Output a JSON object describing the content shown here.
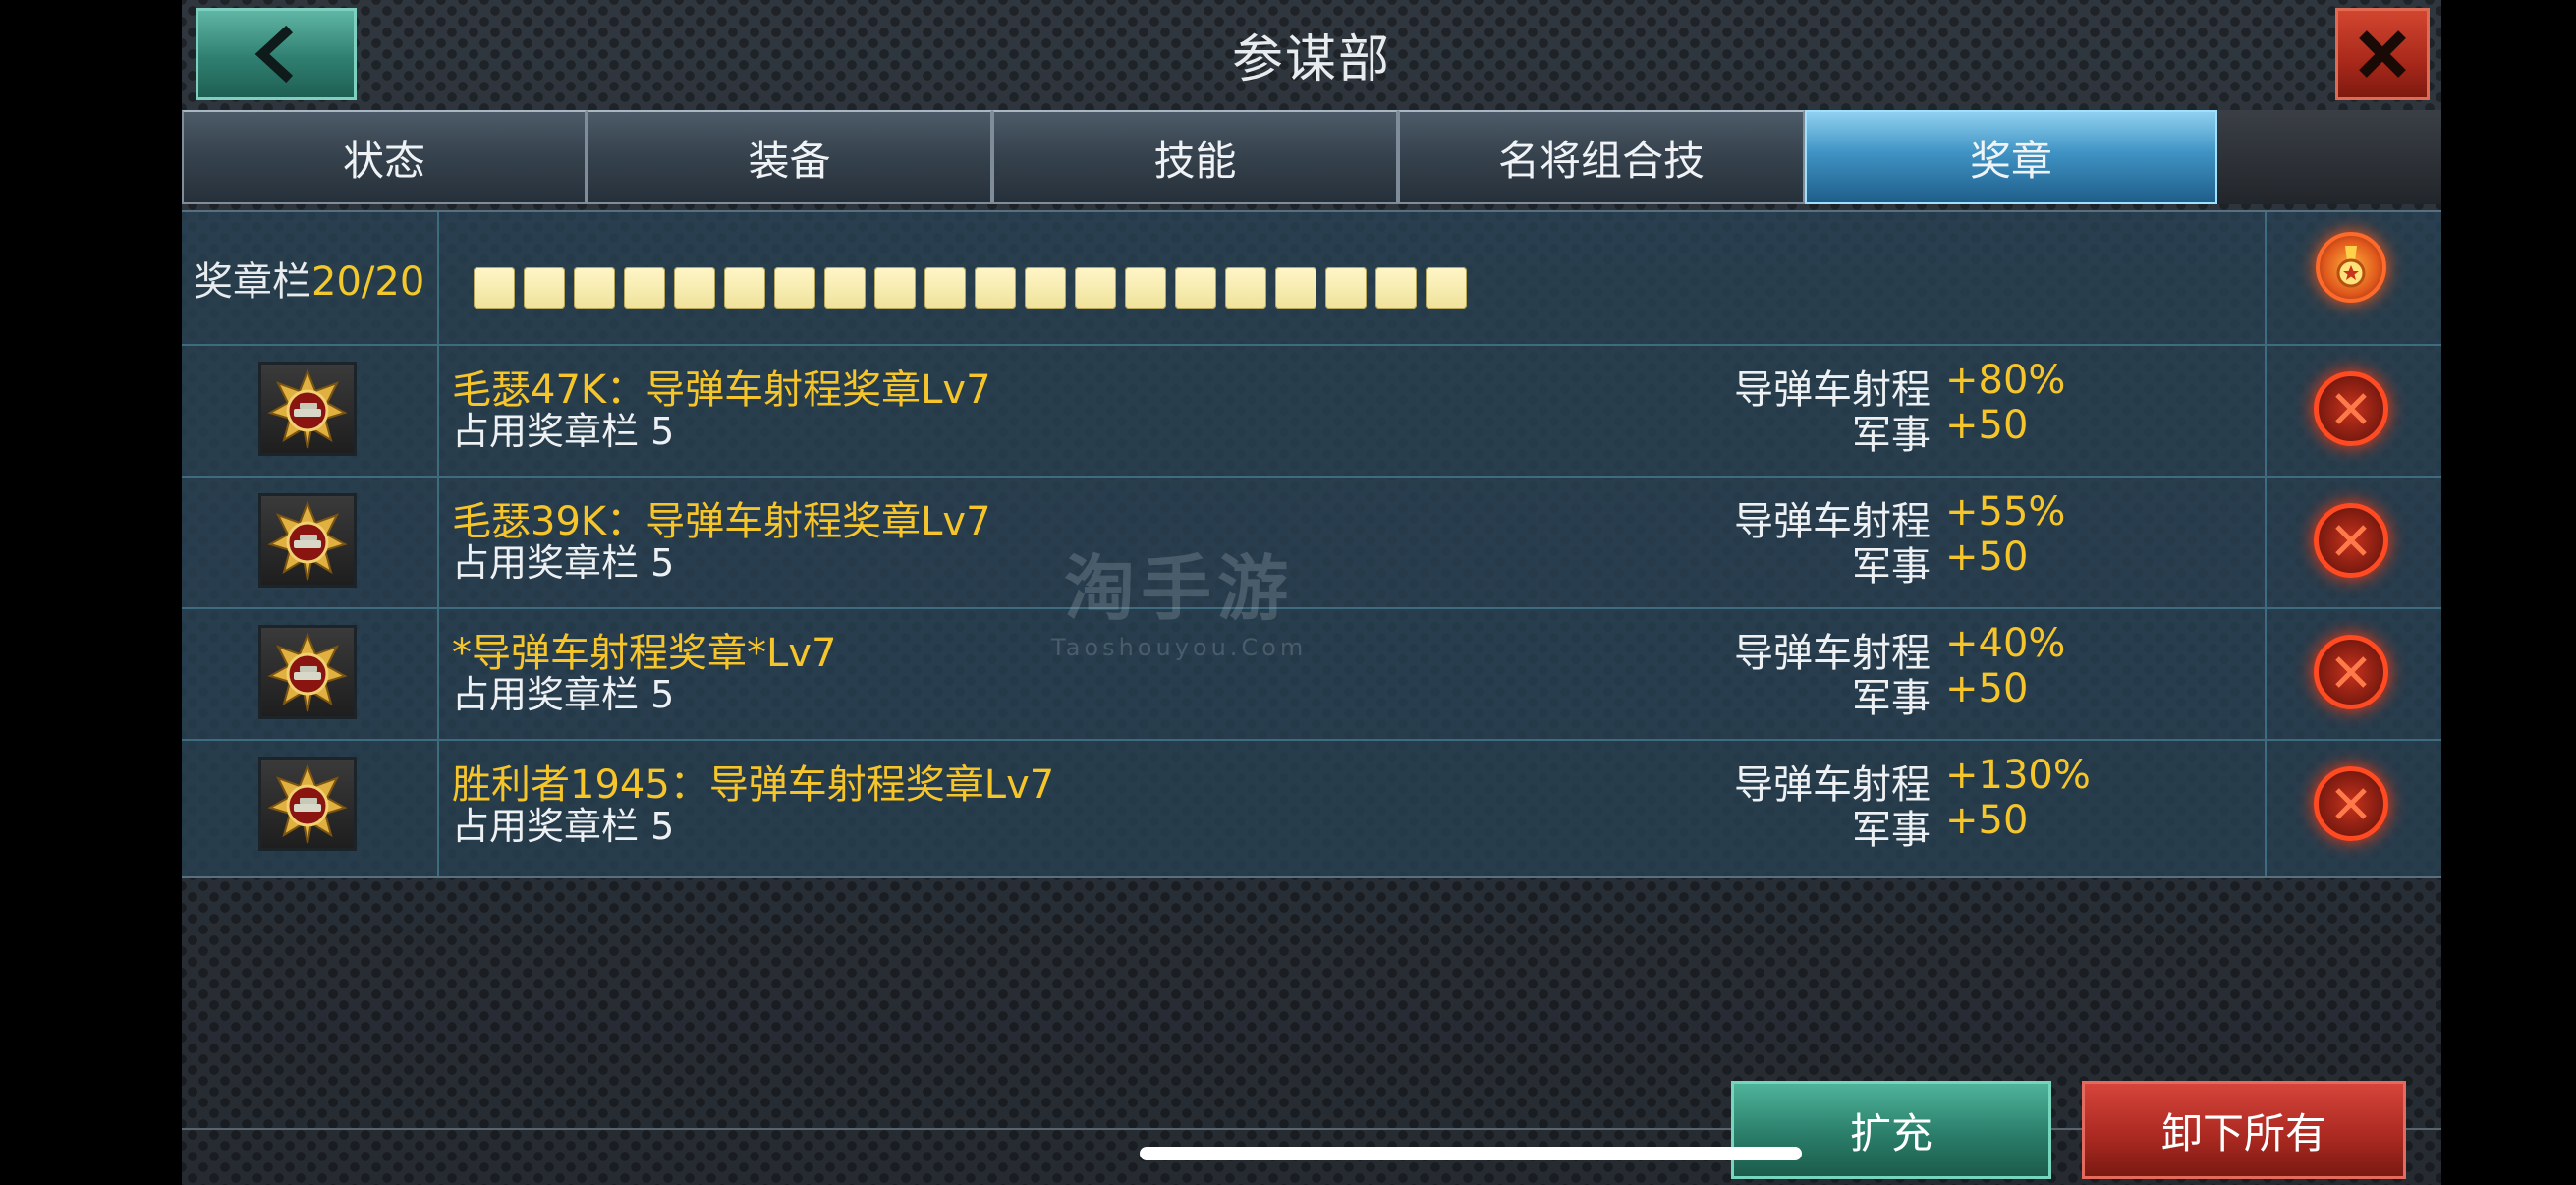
{
  "header": {
    "title": "参谋部",
    "back_icon": "chevron-left-icon",
    "close_icon": "close-icon"
  },
  "tabs": [
    {
      "label": "状态",
      "active": false
    },
    {
      "label": "装备",
      "active": false
    },
    {
      "label": "技能",
      "active": false
    },
    {
      "label": "名将组合技",
      "active": false
    },
    {
      "label": "奖章",
      "active": true
    }
  ],
  "slots": {
    "label": "奖章栏",
    "count": "20/20",
    "filled": 20,
    "total": 20
  },
  "medals": [
    {
      "name": "毛瑟47K：导弹车射程奖章Lv7",
      "cost": "占用奖章栏 5",
      "stat1_label": "导弹车射程",
      "stat1_value": "+80%",
      "stat2_label": "军事",
      "stat2_value": "+50"
    },
    {
      "name": "毛瑟39K：导弹车射程奖章Lv7",
      "cost": "占用奖章栏 5",
      "stat1_label": "导弹车射程",
      "stat1_value": "+55%",
      "stat2_label": "军事",
      "stat2_value": "+50"
    },
    {
      "name": "*导弹车射程奖章*Lv7",
      "cost": "占用奖章栏 5",
      "stat1_label": "导弹车射程",
      "stat1_value": "+40%",
      "stat2_label": "军事",
      "stat2_value": "+50"
    },
    {
      "name": "胜利者1945：导弹车射程奖章Lv7",
      "cost": "占用奖章栏 5",
      "stat1_label": "导弹车射程",
      "stat1_value": "+130%",
      "stat2_label": "军事",
      "stat2_value": "+50"
    }
  ],
  "watermark": {
    "big": "淘手游",
    "small": "Taoshouyou.Com"
  },
  "footer": {
    "expand_label": "扩充",
    "unequip_all_label": "卸下所有"
  },
  "colors": {
    "accent_yellow": "#f6c52a",
    "remove_red": "#ff4a22",
    "tab_active": "#3f93c4"
  }
}
